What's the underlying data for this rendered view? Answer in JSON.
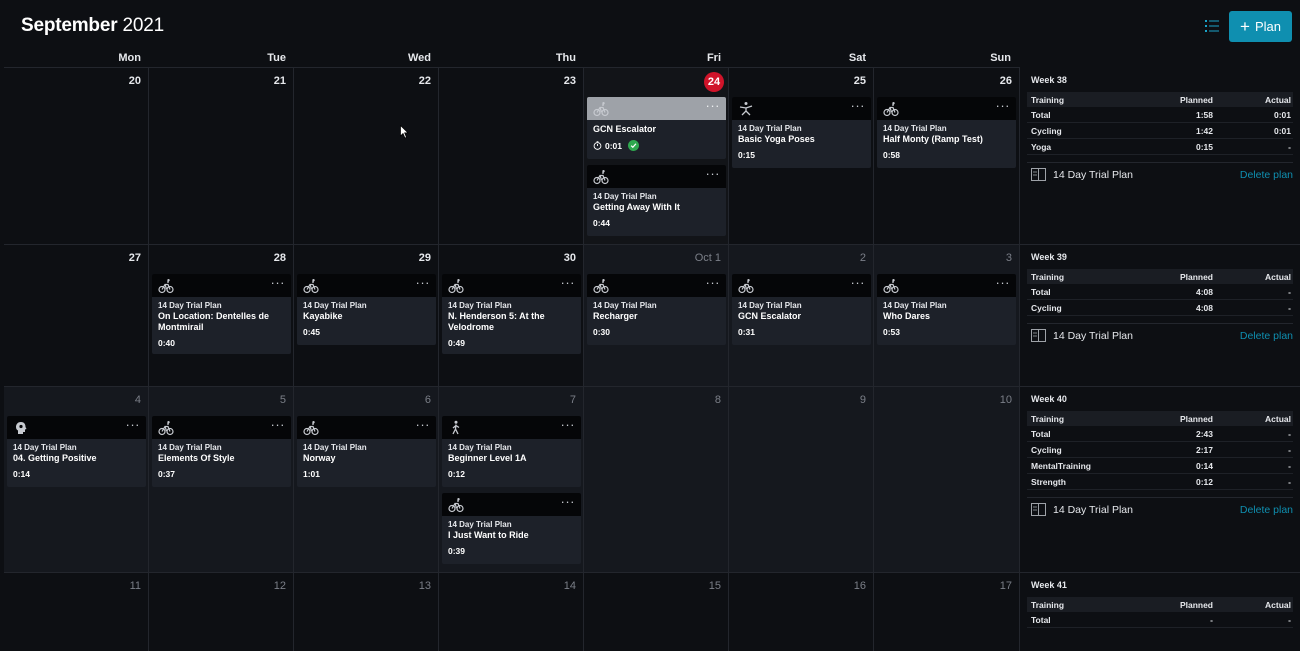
{
  "header": {
    "month": "September",
    "year": "2021",
    "plan_button": "Plan"
  },
  "weekdays": [
    "Mon",
    "Tue",
    "Wed",
    "Thu",
    "Fri",
    "Sat",
    "Sun"
  ],
  "days": {
    "d20": "20",
    "d21": "21",
    "d22": "22",
    "d23": "23",
    "d24": "24",
    "d25": "25",
    "d26": "26",
    "d27": "27",
    "d28": "28",
    "d29": "29",
    "d30": "30",
    "doct1": "Oct 1",
    "d2": "2",
    "d3": "3",
    "d4": "4",
    "d5": "5",
    "d6": "6",
    "d7": "7",
    "d8": "8",
    "d9": "9",
    "d10": "10",
    "d11": "11",
    "d12": "12",
    "d13": "13",
    "d14": "14",
    "d15": "15",
    "d16": "16",
    "d17": "17"
  },
  "workouts": {
    "w1": {
      "sport": "cycling-icon",
      "plan": "",
      "name": "GCN Escalator",
      "duration": "0:01",
      "completed": true
    },
    "w2": {
      "sport": "cycling-icon",
      "plan": "14 Day Trial Plan",
      "name": "Getting Away With It",
      "duration": "0:44"
    },
    "w3": {
      "sport": "yoga-icon",
      "plan": "14 Day Trial Plan",
      "name": "Basic Yoga Poses",
      "duration": "0:15"
    },
    "w4": {
      "sport": "cycling-icon",
      "plan": "14 Day Trial Plan",
      "name": "Half Monty (Ramp Test)",
      "duration": "0:58"
    },
    "w5": {
      "sport": "cycling-icon",
      "plan": "14 Day Trial Plan",
      "name": "On Location: Dentelles de Montmirail",
      "duration": "0:40"
    },
    "w6": {
      "sport": "cycling-icon",
      "plan": "14 Day Trial Plan",
      "name": "Kayabike",
      "duration": "0:45"
    },
    "w7": {
      "sport": "cycling-icon",
      "plan": "14 Day Trial Plan",
      "name": "N. Henderson 5: At the Velodrome",
      "duration": "0:49"
    },
    "w8": {
      "sport": "cycling-icon",
      "plan": "14 Day Trial Plan",
      "name": "Recharger",
      "duration": "0:30"
    },
    "w9": {
      "sport": "cycling-icon",
      "plan": "14 Day Trial Plan",
      "name": "GCN Escalator",
      "duration": "0:31"
    },
    "w10": {
      "sport": "cycling-icon",
      "plan": "14 Day Trial Plan",
      "name": "Who Dares",
      "duration": "0:53"
    },
    "w11": {
      "sport": "mental-training-icon",
      "plan": "14 Day Trial Plan",
      "name": "04. Getting Positive",
      "duration": "0:14"
    },
    "w12": {
      "sport": "cycling-icon",
      "plan": "14 Day Trial Plan",
      "name": "Elements Of Style",
      "duration": "0:37"
    },
    "w13": {
      "sport": "cycling-icon",
      "plan": "14 Day Trial Plan",
      "name": "Norway",
      "duration": "1:01"
    },
    "w14": {
      "sport": "strength-icon",
      "plan": "14 Day Trial Plan",
      "name": "Beginner Level 1A",
      "duration": "0:12"
    },
    "w15": {
      "sport": "cycling-icon",
      "plan": "14 Day Trial Plan",
      "name": "I Just Want to Ride",
      "duration": "0:39"
    }
  },
  "more_glyph": "···",
  "weeks": [
    {
      "title": "Week 38",
      "cols": [
        "Training",
        "Planned",
        "Actual"
      ],
      "rows": [
        {
          "label": "Total",
          "planned": "1:58",
          "actual": "0:01"
        },
        {
          "label": "Cycling",
          "planned": "1:42",
          "actual": "0:01"
        },
        {
          "label": "Yoga",
          "planned": "0:15",
          "actual": "-"
        }
      ],
      "plan": "14 Day Trial Plan",
      "delete": "Delete plan"
    },
    {
      "title": "Week 39",
      "cols": [
        "Training",
        "Planned",
        "Actual"
      ],
      "rows": [
        {
          "label": "Total",
          "planned": "4:08",
          "actual": "-"
        },
        {
          "label": "Cycling",
          "planned": "4:08",
          "actual": "-"
        }
      ],
      "plan": "14 Day Trial Plan",
      "delete": "Delete plan"
    },
    {
      "title": "Week 40",
      "cols": [
        "Training",
        "Planned",
        "Actual"
      ],
      "rows": [
        {
          "label": "Total",
          "planned": "2:43",
          "actual": "-"
        },
        {
          "label": "Cycling",
          "planned": "2:17",
          "actual": "-"
        },
        {
          "label": "MentalTraining",
          "planned": "0:14",
          "actual": "-"
        },
        {
          "label": "Strength",
          "planned": "0:12",
          "actual": "-"
        }
      ],
      "plan": "14 Day Trial Plan",
      "delete": "Delete plan"
    },
    {
      "title": "Week 41",
      "cols": [
        "Training",
        "Planned",
        "Actual"
      ],
      "rows": [
        {
          "label": "Total",
          "planned": "-",
          "actual": "-"
        }
      ]
    }
  ]
}
